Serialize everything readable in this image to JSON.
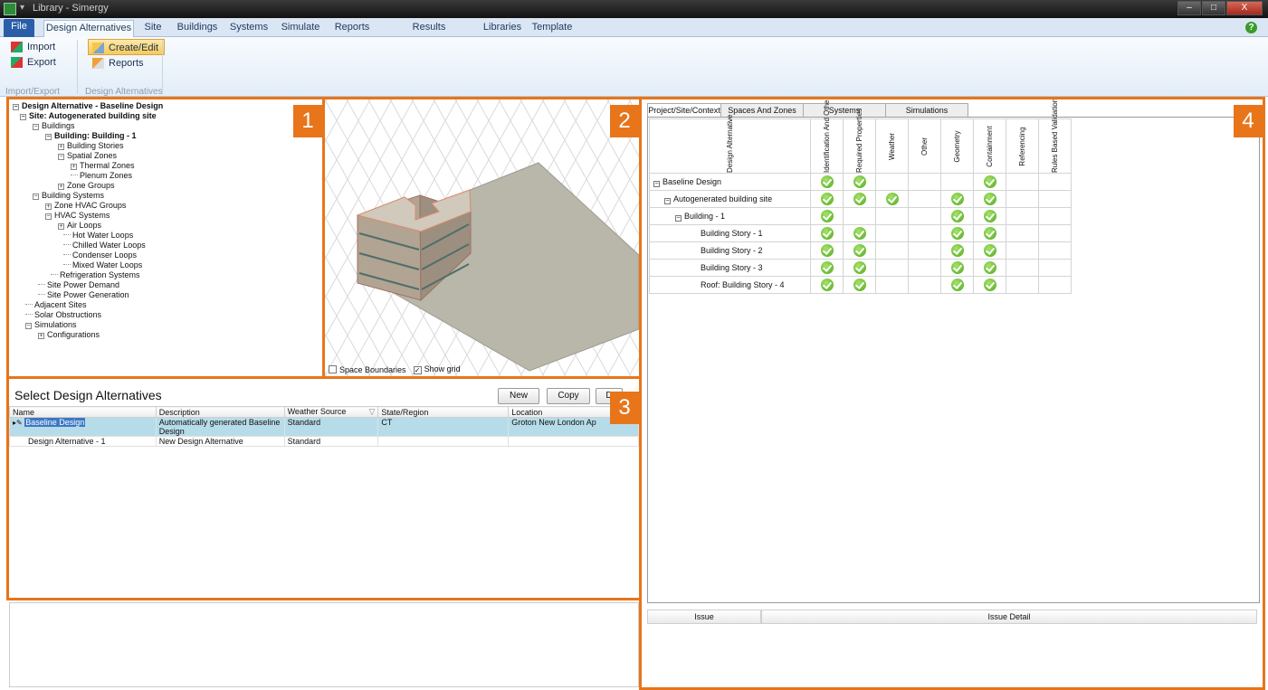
{
  "window": {
    "title": "Library - Simergy",
    "min": "–",
    "max": "□",
    "close": "X",
    "qat": "▾"
  },
  "tabs": [
    "File",
    "Design Alternatives",
    "Site",
    "Buildings",
    "Systems",
    "Simulate",
    "Reports",
    "Results Visualization",
    "Libraries",
    "Template"
  ],
  "help": "?",
  "ribbon": {
    "import": "Import",
    "export": "Export",
    "create_edit": "Create/Edit",
    "reports": "Reports",
    "group1": "Import/Export",
    "group2": "Design Alternatives"
  },
  "panels": {
    "p1": "1",
    "p2": "2",
    "p3": "3",
    "p4": "4"
  },
  "tree": [
    {
      "label": "Design Alternative - Baseline Design",
      "exp": "−",
      "bold": true
    },
    {
      "label": "Site: Autogenerated building site",
      "exp": "−",
      "bold": true
    },
    {
      "label": "Buildings",
      "exp": "−"
    },
    {
      "label": "Building: Building - 1",
      "exp": "−",
      "bold": true
    },
    {
      "label": "Building Stories",
      "exp": "+"
    },
    {
      "label": "Spatial Zones",
      "exp": "−"
    },
    {
      "label": "Thermal Zones",
      "exp": "+"
    },
    {
      "label": "Plenum Zones",
      "exp": ""
    },
    {
      "label": "Zone Groups",
      "exp": "+"
    },
    {
      "label": "Building Systems",
      "exp": "−"
    },
    {
      "label": "Zone HVAC Groups",
      "exp": "+"
    },
    {
      "label": "HVAC Systems",
      "exp": "−"
    },
    {
      "label": "Air Loops",
      "exp": "+"
    },
    {
      "label": "Hot Water Loops",
      "exp": ""
    },
    {
      "label": "Chilled Water Loops",
      "exp": ""
    },
    {
      "label": "Condenser Loops",
      "exp": ""
    },
    {
      "label": "Mixed Water Loops",
      "exp": ""
    },
    {
      "label": "Refrigeration Systems",
      "exp": ""
    },
    {
      "label": "Site Power Demand",
      "exp": ""
    },
    {
      "label": "Site Power Generation",
      "exp": ""
    },
    {
      "label": "Adjacent Sites",
      "exp": ""
    },
    {
      "label": "Solar Obstructions",
      "exp": ""
    },
    {
      "label": "Simulations",
      "exp": "−"
    },
    {
      "label": "Configurations",
      "exp": "+"
    }
  ],
  "view3d": {
    "space_boundaries": "Space Boundaries",
    "show_grid": "Show grid",
    "show_grid_checked": true,
    "space_boundaries_checked": false,
    "check": "✓"
  },
  "grid": {
    "title": "Select Design Alternatives",
    "buttons": [
      "New",
      "Copy",
      "D"
    ],
    "columns": [
      "Name",
      "Description",
      "Weather Source",
      "State/Region",
      "Location"
    ],
    "sort_glyph": "▽",
    "row_marker": "▸✎",
    "rows": [
      {
        "name": "Baseline Design",
        "description": "Automatically generated Baseline Design",
        "weather": "Standard",
        "state": "CT",
        "location": "Groton New London Ap",
        "selected": true
      },
      {
        "name": "Design Alternative - 1",
        "description": "New Design Alternative",
        "weather": "Standard",
        "state": "",
        "location": "",
        "selected": false
      }
    ]
  },
  "validation": {
    "tabs": [
      "Project/Site/Context",
      "Spaces And Zones",
      "Systems",
      "Simulations"
    ],
    "columns": [
      "Design Alternative",
      "Identification And Other Data",
      "Required Properties",
      "Weather",
      "Other",
      "Geometry",
      "Containment",
      "Referencing",
      "Rules Based Validation"
    ],
    "rows": [
      {
        "label": "Baseline Design",
        "exp": "−",
        "checks": [
          true,
          true,
          false,
          false,
          false,
          true,
          false,
          false
        ]
      },
      {
        "label": "Autogenerated building site",
        "exp": "−",
        "checks": [
          true,
          true,
          true,
          false,
          true,
          true,
          false,
          false
        ]
      },
      {
        "label": "Building - 1",
        "exp": "−",
        "checks": [
          true,
          false,
          false,
          false,
          true,
          true,
          false,
          false
        ]
      },
      {
        "label": "Building Story - 1",
        "exp": "",
        "checks": [
          true,
          true,
          false,
          false,
          true,
          true,
          false,
          false
        ]
      },
      {
        "label": "Building Story - 2",
        "exp": "",
        "checks": [
          true,
          true,
          false,
          false,
          true,
          true,
          false,
          false
        ]
      },
      {
        "label": "Building Story - 3",
        "exp": "",
        "checks": [
          true,
          true,
          false,
          false,
          true,
          true,
          false,
          false
        ]
      },
      {
        "label": "Roof: Building Story - 4",
        "exp": "",
        "checks": [
          true,
          true,
          false,
          false,
          true,
          true,
          false,
          false
        ]
      }
    ],
    "issue_col": "Issue",
    "issue_detail_col": "Issue Detail"
  },
  "colors": {
    "accent": "#e8751a",
    "ribbon_tab": "#2b5ea8",
    "ok": "#4ea81d",
    "selected_row": "#b7dce9"
  },
  "icons": [
    "import-icon",
    "export-icon",
    "create-edit-icon",
    "reports-icon",
    "check-icon",
    "help-icon",
    "app-icon"
  ]
}
